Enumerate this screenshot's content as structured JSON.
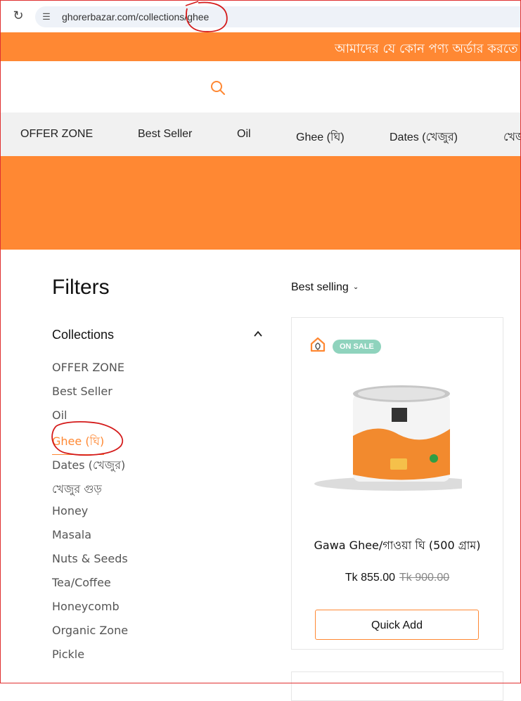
{
  "browser": {
    "url": "ghorerbazar.com/collections/ghee"
  },
  "announcement": {
    "text": "আমাদের যে কোন পণ্য অর্ডার করতে ক"
  },
  "nav": {
    "items": [
      "OFFER ZONE",
      "Best Seller",
      "Oil",
      "Ghee (ঘি)",
      "Dates (খেজুর)",
      "খেজু"
    ]
  },
  "filters": {
    "title": "Filters",
    "collections_label": "Collections",
    "collections": [
      "OFFER ZONE",
      "Best Seller",
      "Oil",
      "Ghee (ঘি)",
      "Dates (খেজুর)",
      "খেজুর গুড়",
      "Honey",
      "Masala",
      "Nuts & Seeds",
      "Tea/Coffee",
      "Honeycomb",
      "Organic Zone",
      "Pickle"
    ],
    "active": "Ghee (ঘি)"
  },
  "sort": {
    "label": "Best selling"
  },
  "product": {
    "badge": "ON SALE",
    "title": "Gawa Ghee/গাওয়া ঘি (500 গ্রাম)",
    "price": "Tk 855.00",
    "compare_price": "Tk 900.00",
    "quick_add": "Quick Add"
  },
  "colors": {
    "accent": "#ff8833",
    "sale_badge": "#8fd3bd",
    "nav_bg": "#f1f1f1"
  },
  "icons": {
    "reload": "reload-icon",
    "site_info": "site-info-icon",
    "search": "search-icon",
    "chevron_up": "chevron-up-icon",
    "chevron_down": "chevron-down-icon"
  }
}
